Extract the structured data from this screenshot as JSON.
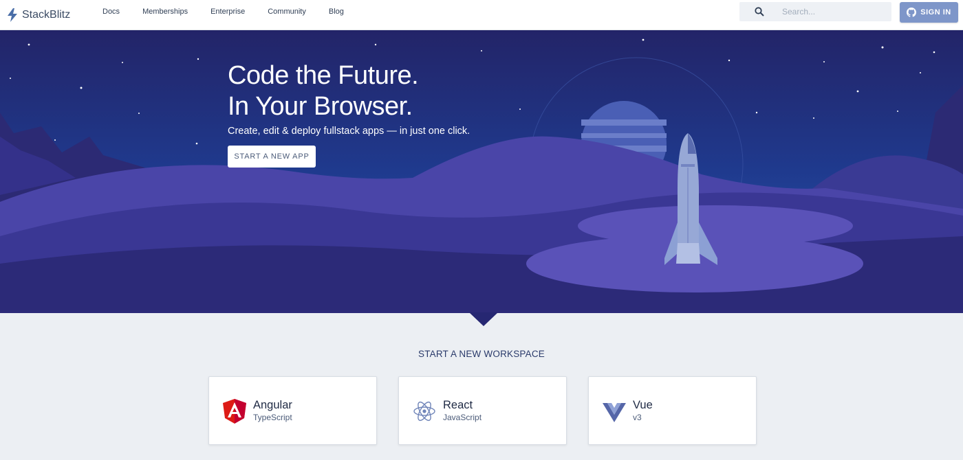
{
  "brand": {
    "name": "StackBlitz",
    "icon": "bolt-icon"
  },
  "nav": {
    "links": [
      "Docs",
      "Memberships",
      "Enterprise",
      "Community",
      "Blog"
    ]
  },
  "search": {
    "placeholder": "Search...",
    "icon": "search-icon"
  },
  "signin": {
    "label": "SIGN IN",
    "icon": "github-icon"
  },
  "hero": {
    "title_line1": "Code the Future.",
    "title_line2": "In Your Browser.",
    "subtitle": "Create, edit & deploy fullstack apps — in just one click.",
    "button_label": "START A NEW APP"
  },
  "workspace": {
    "title": "START A NEW WORKSPACE",
    "cards": [
      {
        "name": "Angular",
        "sub": "TypeScript",
        "icon": "angular-icon",
        "color": "#dd1b16"
      },
      {
        "name": "React",
        "sub": "JavaScript",
        "icon": "react-icon",
        "color": "#6f84b8"
      },
      {
        "name": "Vue",
        "sub": "v3",
        "icon": "vue-icon",
        "color": "#5566a8"
      }
    ]
  },
  "colors": {
    "hero_bg": "#262772",
    "accent": "#7e96c9",
    "page_bg": "#eceff3"
  }
}
